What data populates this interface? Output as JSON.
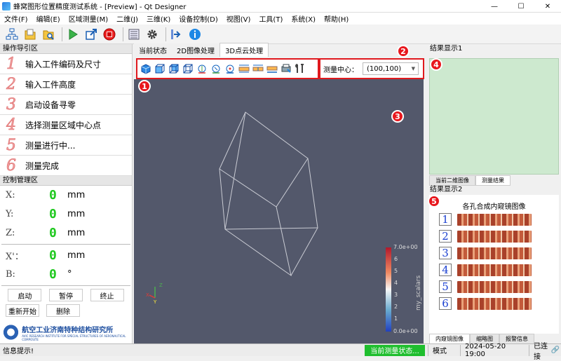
{
  "window": {
    "title": "蜂窝图形位置精度测试系统 - [Preview] - Qt Designer"
  },
  "menu": [
    "文件(F)",
    "编辑(E)",
    "区域测量(M)",
    "二维(J)",
    "三维(K)",
    "设备控制(D)",
    "视图(V)",
    "工具(T)",
    "系统(X)",
    "帮助(H)"
  ],
  "toolbar": {
    "icons": [
      "structure-icon",
      "folder-icon",
      "search-file-icon",
      "play-icon",
      "export-icon",
      "stop-icon",
      "list-icon",
      "gear-icon",
      "arrow-right-icon",
      "info-icon"
    ]
  },
  "left": {
    "nav_title": "操作导引区",
    "steps": [
      {
        "num": "1",
        "label": "输入工件编码及尺寸"
      },
      {
        "num": "2",
        "label": "输入工件高度"
      },
      {
        "num": "3",
        "label": "启动设备寻零"
      },
      {
        "num": "4",
        "label": "选择测量区域中心点"
      },
      {
        "num": "5",
        "label": "测量进行中..."
      },
      {
        "num": "6",
        "label": "测量完成"
      }
    ],
    "ctrl_title": "控制管理区",
    "axes": [
      {
        "axis": "X:",
        "value": "0",
        "unit": "mm"
      },
      {
        "axis": "Y:",
        "value": "0",
        "unit": "mm"
      },
      {
        "axis": "Z:",
        "value": "0",
        "unit": "mm"
      },
      {
        "axis": "X'：",
        "value": "0",
        "unit": "mm"
      },
      {
        "axis": "B:",
        "value": "0",
        "unit": "°"
      }
    ],
    "buttons": [
      "启动",
      "暂停",
      "终止",
      "重新开始",
      "删除"
    ],
    "org_cn": "航空工业济南特种结构研究所",
    "org_en": "AVIC RESEARCH INSTITUTE FOR SPECIAL STRUCTURES OF AERONAUTICAL COMPOSITE"
  },
  "center": {
    "tabs": [
      "当前状态",
      "2D图像处理",
      "3D点云处理"
    ],
    "active_tab": "3D点云处理",
    "measure_center_label": "测量中心：",
    "measure_center_value": "(100,100)",
    "colorbar": {
      "max": "7.0e+00",
      "min": "0.0e+00",
      "ticks": [
        "6",
        "5",
        "4",
        "3",
        "2",
        "1"
      ],
      "label": "my_scalars"
    },
    "markers": [
      "1",
      "2",
      "3"
    ]
  },
  "right": {
    "result1_title": "结果显示1",
    "result1_tabs": [
      "当前二维图像",
      "测量结果"
    ],
    "result2_title": "结果显示2",
    "endo_title": "各孔合成内窥镜图像",
    "endo_items": [
      "1",
      "2",
      "3",
      "4",
      "5",
      "6"
    ],
    "result2_tabs": [
      "内窥镜图像",
      "缩略图",
      "报警信息"
    ],
    "markers": [
      "4",
      "5"
    ]
  },
  "status": {
    "info": "信息提示!",
    "state": "当前测量状态...",
    "mode": "模式",
    "datetime": "2024-05-20 19:00",
    "connection": "已连接"
  },
  "colors": {
    "accent_red": "#e0191e",
    "lcd_green": "#1ec81e",
    "result_green": "#cde9cf",
    "status_green": "#1fbe2e",
    "viewport": "#53586b"
  }
}
